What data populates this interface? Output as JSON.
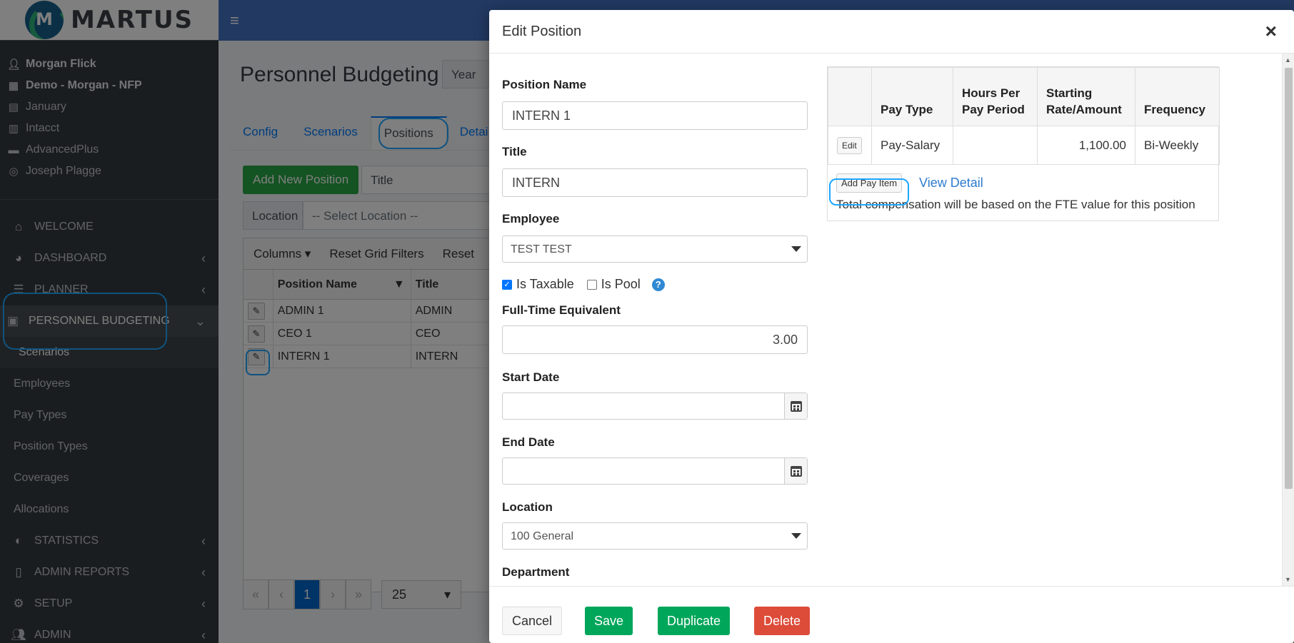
{
  "sidebar": {
    "logo_text": "MARTUS",
    "logo_letter": "M",
    "user_lines": [
      {
        "icon": "user-icon",
        "text": "Morgan Flick"
      },
      {
        "icon": "building-icon",
        "text": "Demo - Morgan - NFP"
      },
      {
        "icon": "calendar-icon",
        "text": "January"
      },
      {
        "icon": "book-icon",
        "text": "Intacct"
      },
      {
        "icon": "briefcase-icon",
        "text": "AdvancedPlus"
      },
      {
        "icon": "headset-icon",
        "text": "Joseph Plagge"
      }
    ],
    "nav": {
      "welcome": "WELCOME",
      "dashboard": "DASHBOARD",
      "planner": "PLANNER",
      "personnel_budgeting": "PERSONNEL BUDGETING",
      "sub": [
        "Scenarios",
        "Employees",
        "Pay Types",
        "Position Types",
        "Coverages",
        "Allocations"
      ],
      "statistics": "STATISTICS",
      "admin_reports": "ADMIN REPORTS",
      "setup": "SETUP",
      "admin": "ADMIN"
    }
  },
  "main": {
    "page_title": "Personnel Budgeting",
    "year_label": "Year",
    "tabs": [
      "Config",
      "Scenarios",
      "Positions",
      "Detai"
    ],
    "add_position_label": "Add New Position",
    "title_filter_label": "Title",
    "location_label": "Location",
    "location_placeholder": "-- Select Location --",
    "grid_toolbar": {
      "columns": "Columns ▾",
      "reset_filters": "Reset Grid Filters",
      "reset": "Reset"
    },
    "grid_headers": [
      "Position Name",
      "Title"
    ],
    "grid_rows": [
      {
        "name": "ADMIN 1",
        "title": "ADMIN"
      },
      {
        "name": "CEO 1",
        "title": "CEO"
      },
      {
        "name": "INTERN 1",
        "title": "INTERN"
      }
    ],
    "pager": {
      "current": "1",
      "page_size": "25"
    }
  },
  "modal": {
    "title": "Edit Position",
    "close": "×",
    "position_name_label": "Position Name",
    "position_name_value": "INTERN 1",
    "title_label": "Title",
    "title_value": "INTERN",
    "employee_label": "Employee",
    "employee_value": "TEST TEST",
    "is_taxable_label": "Is Taxable",
    "is_pool_label": "Is Pool",
    "help": "?",
    "fte_label": "Full-Time Equivalent",
    "fte_value": "3.00",
    "start_date_label": "Start Date",
    "end_date_label": "End Date",
    "location_label": "Location",
    "location_value": "100 General",
    "department_label": "Department",
    "pay_table": {
      "headers": [
        "Pay Type",
        "Hours Per Pay Period",
        "Starting Rate/Amount",
        "Frequency"
      ],
      "rows": [
        {
          "edit": "Edit",
          "pay_type": "Pay-Salary",
          "hours": "",
          "rate": "1,100.00",
          "frequency": "Bi-Weekly"
        }
      ],
      "add_pay_item": "Add Pay Item",
      "view_detail": "View Detail",
      "note": "Total compensation will be based on the FTE value for this position"
    },
    "footer": {
      "cancel": "Cancel",
      "save": "Save",
      "duplicate": "Duplicate",
      "delete": "Delete"
    }
  }
}
